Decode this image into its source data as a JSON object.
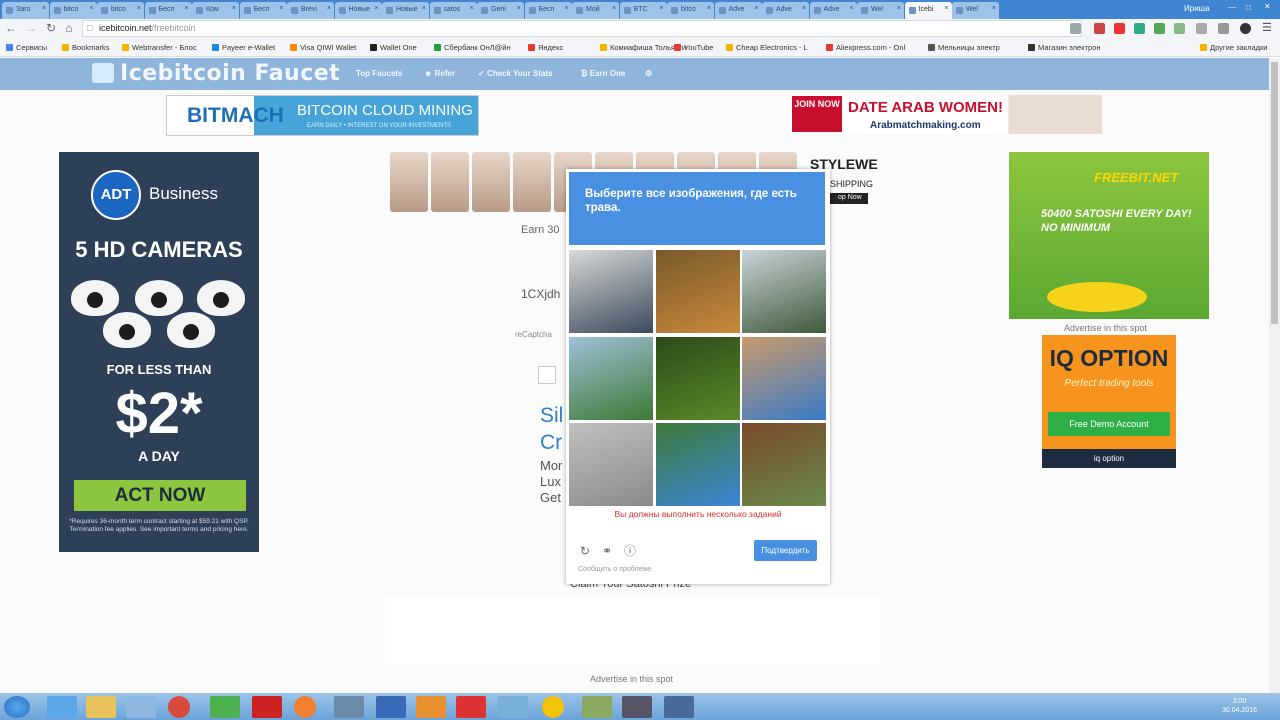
{
  "browser": {
    "tabs": [
      {
        "label": "Заго",
        "active": false
      },
      {
        "label": "bitco",
        "active": false
      },
      {
        "label": "bitco",
        "active": false
      },
      {
        "label": "Бесп",
        "active": false
      },
      {
        "label": "Ком",
        "active": false
      },
      {
        "label": "Бесп",
        "active": false
      },
      {
        "label": "Brevi",
        "active": false
      },
      {
        "label": "Новые",
        "active": false
      },
      {
        "label": "Новые",
        "active": false
      },
      {
        "label": "satos",
        "active": false
      },
      {
        "label": "Geni",
        "active": false
      },
      {
        "label": "Бесп",
        "active": false
      },
      {
        "label": "Мой",
        "active": false
      },
      {
        "label": "BTC",
        "active": false
      },
      {
        "label": "bitco",
        "active": false
      },
      {
        "label": "Adve",
        "active": false
      },
      {
        "label": "Adve",
        "active": false
      },
      {
        "label": "Adve",
        "active": false
      },
      {
        "label": "Wel",
        "active": false
      },
      {
        "label": "Icebi",
        "active": true
      },
      {
        "label": "Wel",
        "active": false
      }
    ],
    "user_label": "Ириша",
    "url_host": "icebitcoin.net",
    "url_path": "/freebitcoin",
    "bookmarks": [
      {
        "label": "Сервисы",
        "color": "#4285f4"
      },
      {
        "label": "Bookmarks",
        "color": "#f4b400"
      },
      {
        "label": "Webtransfer - Блос",
        "color": "#f4b400"
      },
      {
        "label": "Payeer e-Wallet",
        "color": "#1e88e5"
      },
      {
        "label": "Visa QIWI Wallet",
        "color": "#ff8c00"
      },
      {
        "label": "Wallet One",
        "color": "#222222"
      },
      {
        "label": "Сбербанк ОнЛ@йн",
        "color": "#21a038"
      },
      {
        "label": "Яндекс",
        "color": "#e53935"
      },
      {
        "label": "Комиафиша Тольятти",
        "color": "#f4b400"
      },
      {
        "label": "YouTube",
        "color": "#e53935"
      },
      {
        "label": "Cheap Electronics - L",
        "color": "#f4b400"
      },
      {
        "label": "Aliexpress.com - Onl",
        "color": "#e53935"
      },
      {
        "label": "Мельницы электр",
        "color": "#555555"
      },
      {
        "label": "Магазин электрон",
        "color": "#333333"
      }
    ],
    "other_bookmarks": "Другие закладки"
  },
  "site": {
    "logo": "Icebitcoin Faucet",
    "nav": [
      "Top Faucets",
      "Refer",
      "Check Your Stats",
      "Earn One"
    ]
  },
  "ads": {
    "bitmach_brand": "BITMACH",
    "bitmach_main": "BITCOIN CLOUD MINING",
    "bitmach_sub": "EARN DAILY • INTEREST ON YOUR INVESTMENTS",
    "arab_join": "JOIN NOW",
    "arab_title": "DATE ARAB WOMEN!",
    "arab_url": "Arabmatchmaking.com",
    "adt_logo": "ADT",
    "adt_business": "Business",
    "adt_cameras": "5 HD CAMERAS",
    "adt_less": "FOR LESS THAN",
    "adt_price": "$2*",
    "adt_day": "A DAY",
    "adt_act": "ACT NOW",
    "adt_fine": "*Requires 36-month term contract starting at $59.21 with QSP. Termination fee applies. See important terms and pricing here.",
    "stylewe": "STYLEWE",
    "shipping": "SHIPPING",
    "shopnow": "op Now",
    "freebit_name": "FREEBIT.NET",
    "freebit_sat": "50400 SATOSHI EVERY DAY! NO MINIMUM",
    "advertise_right": "Advertise in this spot",
    "iq_title": "IQ OPTION",
    "iq_sub": "Perfect trading tools",
    "iq_button": "Free Demo Account",
    "iq_brand": "iq option"
  },
  "faucet": {
    "earn": "Earn 30",
    "address": "1CXjdh",
    "recaptcha_label": "reCaptcha",
    "silver_line1": "Sil",
    "silver_line2": "Cr",
    "more_line1": "Mor",
    "more_line2": "Lux",
    "more_line3": "Get",
    "claim": "Claim Your Satoshi Prize",
    "advertise_bottom": "Advertise in this spot"
  },
  "captcha": {
    "instruction": "Выберите все изображения, где есть трава.",
    "error": "Вы должны выполнить несколько заданий",
    "report": "Сообщить о проблеме",
    "verify_button": "Подтвердить",
    "tiles": [
      {
        "name": "tile-snowy-bank",
        "color1": "#3a4a5c",
        "color2": "#d9d9d9"
      },
      {
        "name": "tile-food-plate",
        "color1": "#c8893a",
        "color2": "#7a5a2c"
      },
      {
        "name": "tile-mountain-river",
        "color1": "#3e5a3a",
        "color2": "#c9d4d8"
      },
      {
        "name": "tile-lake-trees",
        "color1": "#3d7a35",
        "color2": "#9ec0d8"
      },
      {
        "name": "tile-green-leaf",
        "color1": "#5a8a2a",
        "color2": "#2c4a18"
      },
      {
        "name": "tile-blue-figurine",
        "color1": "#3a7ac8",
        "color2": "#c89a6a"
      },
      {
        "name": "tile-old-building",
        "color1": "#8a8a8a",
        "color2": "#c0c0c0"
      },
      {
        "name": "tile-green-hills",
        "color1": "#3b86d6",
        "color2": "#3f7a3a"
      },
      {
        "name": "tile-wooden-house",
        "color1": "#6a8a4a",
        "color2": "#7a4a2a"
      }
    ]
  },
  "system": {
    "time": "3:00",
    "date": "30.04.2016"
  }
}
